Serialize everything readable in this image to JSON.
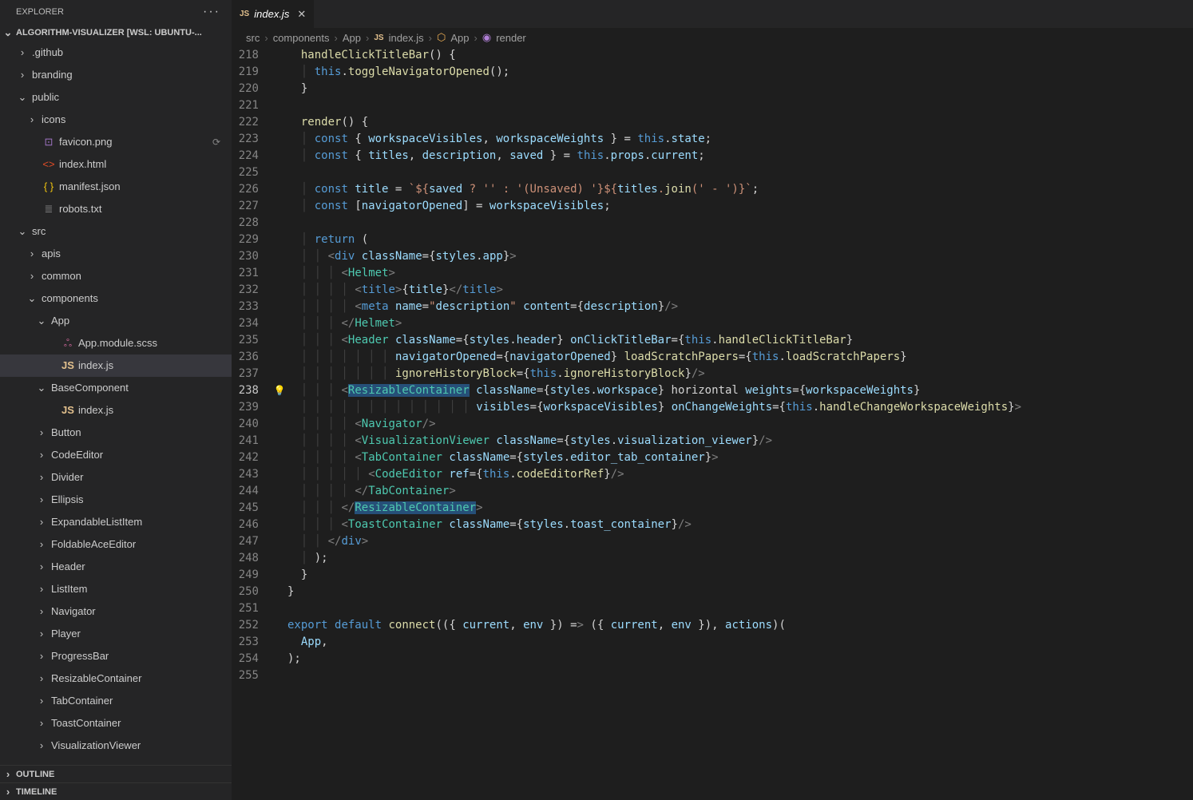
{
  "sidebar": {
    "title": "EXPLORER",
    "project_label": "ALGORITHM-VISUALIZER [WSL: UBUNTU-...",
    "outline_label": "OUTLINE",
    "timeline_label": "TIMELINE",
    "tree": [
      {
        "depth": 0,
        "kind": "folder",
        "open": false,
        "label": ".github"
      },
      {
        "depth": 0,
        "kind": "folder",
        "open": false,
        "label": "branding"
      },
      {
        "depth": 0,
        "kind": "folder",
        "open": true,
        "label": "public"
      },
      {
        "depth": 1,
        "kind": "folder",
        "open": false,
        "label": "icons"
      },
      {
        "depth": 1,
        "kind": "file",
        "ico": "image",
        "label": "favicon.png",
        "modified": true
      },
      {
        "depth": 1,
        "kind": "file",
        "ico": "html",
        "label": "index.html"
      },
      {
        "depth": 1,
        "kind": "file",
        "ico": "json",
        "label": "manifest.json"
      },
      {
        "depth": 1,
        "kind": "file",
        "ico": "txt",
        "label": "robots.txt"
      },
      {
        "depth": 0,
        "kind": "folder",
        "open": true,
        "label": "src"
      },
      {
        "depth": 1,
        "kind": "folder",
        "open": false,
        "label": "apis"
      },
      {
        "depth": 1,
        "kind": "folder",
        "open": false,
        "label": "common"
      },
      {
        "depth": 1,
        "kind": "folder",
        "open": true,
        "label": "components"
      },
      {
        "depth": 2,
        "kind": "folder",
        "open": true,
        "label": "App"
      },
      {
        "depth": 3,
        "kind": "file",
        "ico": "scss",
        "label": "App.module.scss"
      },
      {
        "depth": 3,
        "kind": "file",
        "ico": "js",
        "label": "index.js",
        "active": true
      },
      {
        "depth": 2,
        "kind": "folder",
        "open": true,
        "label": "BaseComponent"
      },
      {
        "depth": 3,
        "kind": "file",
        "ico": "js",
        "label": "index.js"
      },
      {
        "depth": 2,
        "kind": "folder",
        "open": false,
        "label": "Button"
      },
      {
        "depth": 2,
        "kind": "folder",
        "open": false,
        "label": "CodeEditor"
      },
      {
        "depth": 2,
        "kind": "folder",
        "open": false,
        "label": "Divider"
      },
      {
        "depth": 2,
        "kind": "folder",
        "open": false,
        "label": "Ellipsis"
      },
      {
        "depth": 2,
        "kind": "folder",
        "open": false,
        "label": "ExpandableListItem"
      },
      {
        "depth": 2,
        "kind": "folder",
        "open": false,
        "label": "FoldableAceEditor"
      },
      {
        "depth": 2,
        "kind": "folder",
        "open": false,
        "label": "Header"
      },
      {
        "depth": 2,
        "kind": "folder",
        "open": false,
        "label": "ListItem"
      },
      {
        "depth": 2,
        "kind": "folder",
        "open": false,
        "label": "Navigator"
      },
      {
        "depth": 2,
        "kind": "folder",
        "open": false,
        "label": "Player"
      },
      {
        "depth": 2,
        "kind": "folder",
        "open": false,
        "label": "ProgressBar"
      },
      {
        "depth": 2,
        "kind": "folder",
        "open": false,
        "label": "ResizableContainer"
      },
      {
        "depth": 2,
        "kind": "folder",
        "open": false,
        "label": "TabContainer"
      },
      {
        "depth": 2,
        "kind": "folder",
        "open": false,
        "label": "ToastContainer"
      },
      {
        "depth": 2,
        "kind": "folder",
        "open": false,
        "label": "VisualizationViewer"
      }
    ]
  },
  "tabs": [
    {
      "icon": "JS",
      "label": "index.js"
    }
  ],
  "breadcrumb": [
    "src",
    "components",
    "App",
    "index.js",
    "App",
    "render"
  ],
  "code": {
    "start": 218,
    "current": 238,
    "lines": [
      "  handleClickTitleBar() {",
      "    this.toggleNavigatorOpened();",
      "  }",
      "",
      "  render() {",
      "    const { workspaceVisibles, workspaceWeights } = this.state;",
      "    const { titles, description, saved } = this.props.current;",
      "",
      "    const title = `${saved ? '' : '(Unsaved) '}${titles.join(' - ')}`;",
      "    const [navigatorOpened] = workspaceVisibles;",
      "",
      "    return (",
      "      <div className={styles.app}>",
      "        <Helmet>",
      "          <title>{title}</title>",
      "          <meta name=\"description\" content={description}/>",
      "        </Helmet>",
      "        <Header className={styles.header} onClickTitleBar={this.handleClickTitleBar}",
      "                navigatorOpened={navigatorOpened} loadScratchPapers={this.loadScratchPapers}",
      "                ignoreHistoryBlock={this.ignoreHistoryBlock}/>",
      "        <ResizableContainer className={styles.workspace} horizontal weights={workspaceWeights}",
      "                            visibles={workspaceVisibles} onChangeWeights={this.handleChangeWorkspaceWeights}>",
      "          <Navigator/>",
      "          <VisualizationViewer className={styles.visualization_viewer}/>",
      "          <TabContainer className={styles.editor_tab_container}>",
      "            <CodeEditor ref={this.codeEditorRef}/>",
      "          </TabContainer>",
      "        </ResizableContainer>",
      "        <ToastContainer className={styles.toast_container}/>",
      "      </div>",
      "    );",
      "  }",
      "}",
      "",
      "export default connect(({ current, env }) => ({ current, env }), actions)(",
      "  App,",
      ");",
      ""
    ]
  }
}
